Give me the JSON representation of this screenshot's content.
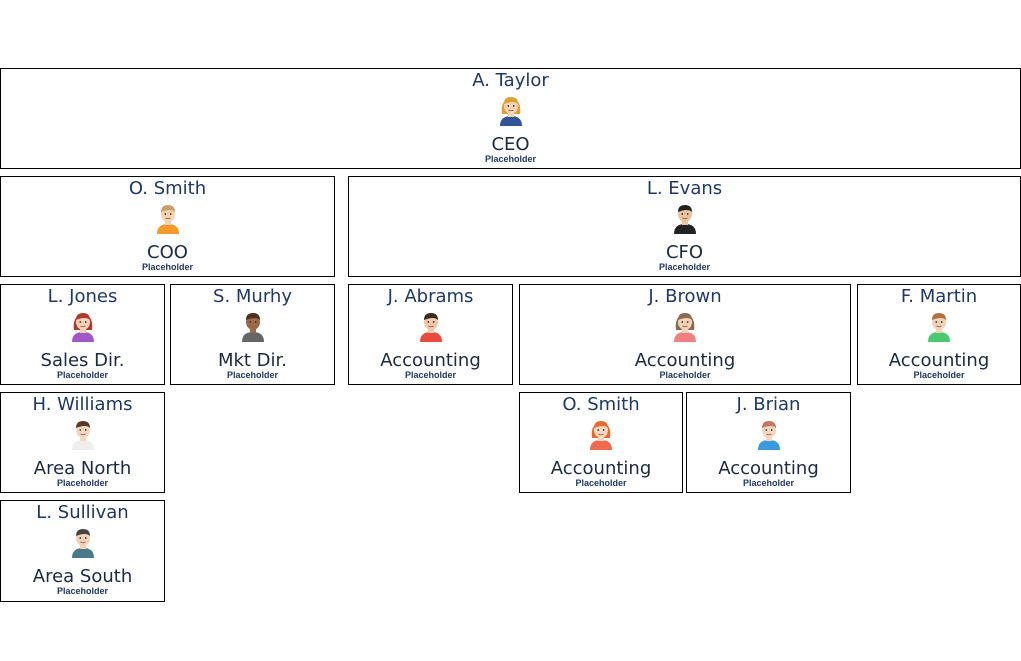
{
  "cards": [
    {
      "name": "A. Taylor",
      "title": "CEO",
      "subtitle": "Placeholder",
      "avatar": {
        "icon": "woman-avatar-icon",
        "hair": "#e0a030",
        "skin": "#f3d2b8",
        "shirt": "#2f5597"
      }
    },
    {
      "name": "O. Smith",
      "title": "COO",
      "subtitle": "Placeholder",
      "avatar": {
        "icon": "man-avatar-icon",
        "hair": "#c8a070",
        "skin": "#f6d3b0",
        "shirt": "#f39a2c"
      }
    },
    {
      "name": "L. Evans",
      "title": "CFO",
      "subtitle": "Placeholder",
      "avatar": {
        "icon": "man-avatar-icon",
        "hair": "#222222",
        "skin": "#e8c4a0",
        "shirt": "#222222"
      }
    },
    {
      "name": "L. Jones",
      "title": "Sales Dir.",
      "subtitle": "Placeholder",
      "avatar": {
        "icon": "woman-avatar-icon",
        "hair": "#b03a2e",
        "skin": "#f3d2b8",
        "shirt": "#a058c8"
      }
    },
    {
      "name": "S. Murhy",
      "title": "Mkt Dir.",
      "subtitle": "Placeholder",
      "avatar": {
        "icon": "man-avatar-icon",
        "hair": "#4a3020",
        "skin": "#9a6a48",
        "shirt": "#666666"
      }
    },
    {
      "name": "J. Abrams",
      "title": "Accounting",
      "subtitle": "Placeholder",
      "avatar": {
        "icon": "man-avatar-icon",
        "hair": "#3a2a20",
        "skin": "#f3c8a8",
        "shirt": "#e84c3c"
      }
    },
    {
      "name": "J. Brown",
      "title": "Accounting",
      "subtitle": "Placeholder",
      "avatar": {
        "icon": "woman-avatar-icon",
        "hair": "#8a6a50",
        "skin": "#f3d2b8",
        "shirt": "#f08080"
      }
    },
    {
      "name": "F. Martin",
      "title": "Accounting",
      "subtitle": "Placeholder",
      "avatar": {
        "icon": "man-avatar-icon",
        "hair": "#b07040",
        "skin": "#f3d2b8",
        "shirt": "#4cc870"
      }
    },
    {
      "name": "H. Williams",
      "title": "Area North",
      "subtitle": "Placeholder",
      "avatar": {
        "icon": "man-avatar-icon",
        "hair": "#5a3a28",
        "skin": "#f3d8c0",
        "shirt": "#eeeeee"
      }
    },
    {
      "name": "O. Smith",
      "title": "Accounting",
      "subtitle": "Placeholder",
      "avatar": {
        "icon": "woman-avatar-icon",
        "hair": "#e86a30",
        "skin": "#f6d8c0",
        "shirt": "#f06a50"
      }
    },
    {
      "name": "J. Brian",
      "title": "Accounting",
      "subtitle": "Placeholder",
      "avatar": {
        "icon": "man-avatar-icon",
        "hair": "#c07860",
        "skin": "#f6d8c0",
        "shirt": "#3a9ae0"
      }
    },
    {
      "name": "L. Sullivan",
      "title": "Area South",
      "subtitle": "Placeholder",
      "avatar": {
        "icon": "man-avatar-icon",
        "hair": "#444444",
        "skin": "#f3d2b8",
        "shirt": "#4a7a8a"
      }
    }
  ]
}
